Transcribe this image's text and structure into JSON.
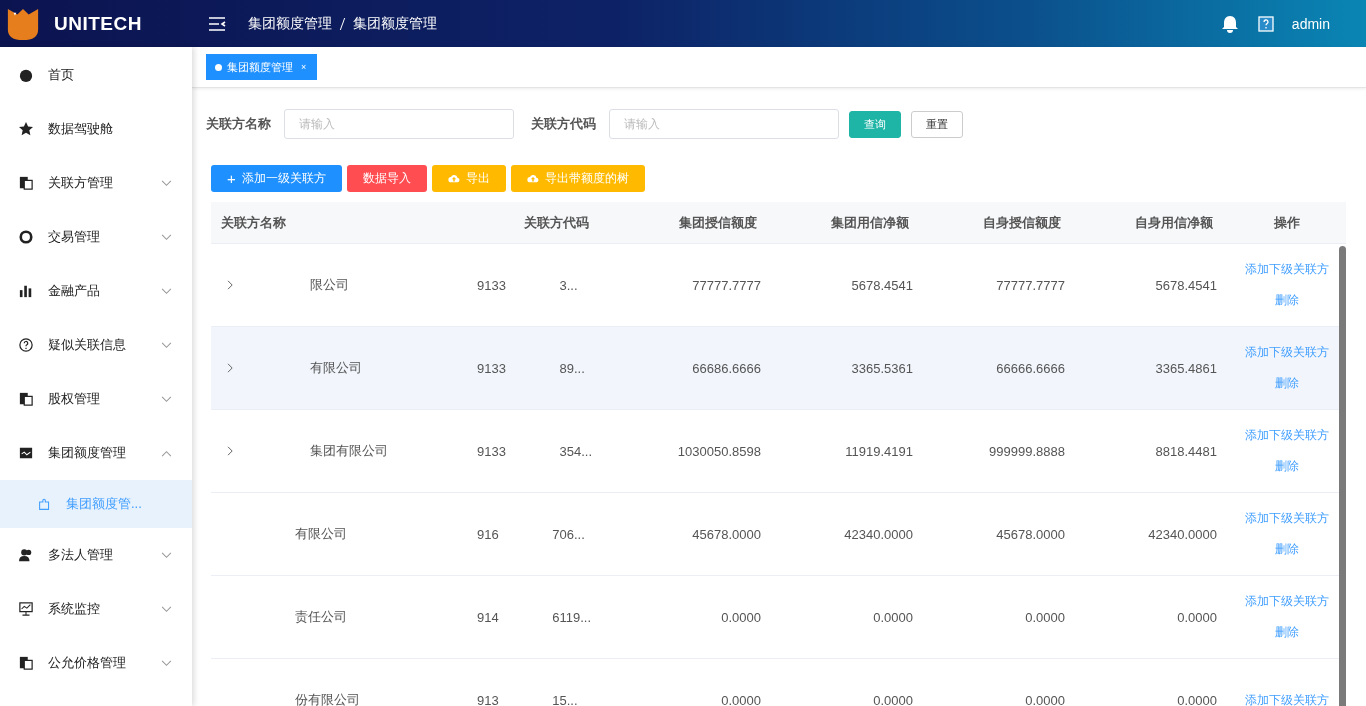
{
  "header": {
    "logo": "UNITECH",
    "breadcrumb": [
      "集团额度管理",
      "集团额度管理"
    ],
    "user": "admin"
  },
  "sidebar": {
    "items": [
      {
        "label": "首页",
        "kind": "link"
      },
      {
        "label": "数据驾驶舱",
        "kind": "link"
      },
      {
        "label": "关联方管理",
        "kind": "submenu",
        "expanded": false
      },
      {
        "label": "交易管理",
        "kind": "submenu",
        "expanded": false
      },
      {
        "label": "金融产品",
        "kind": "submenu",
        "expanded": false
      },
      {
        "label": "疑似关联信息",
        "kind": "submenu",
        "expanded": false
      },
      {
        "label": "股权管理",
        "kind": "submenu",
        "expanded": false
      },
      {
        "label": "集团额度管理",
        "kind": "submenu",
        "expanded": true,
        "children": [
          {
            "label": "集团额度管...",
            "selected": true
          }
        ]
      },
      {
        "label": "多法人管理",
        "kind": "submenu",
        "expanded": false
      },
      {
        "label": "系统监控",
        "kind": "submenu",
        "expanded": false
      },
      {
        "label": "公允价格管理",
        "kind": "submenu",
        "expanded": false
      }
    ]
  },
  "tabs": [
    {
      "label": "集团额度管理",
      "selected": true,
      "close": "×"
    }
  ],
  "filters": [
    {
      "label": "关联方名称",
      "placeholder": "请输入"
    },
    {
      "label": "关联方代码",
      "placeholder": "请输入"
    }
  ],
  "filter_buttons": [
    {
      "label": "查询",
      "kind": "primary"
    },
    {
      "label": "重置",
      "kind": "plain"
    }
  ],
  "toolbar": [
    {
      "label": "添加一级关联方",
      "kind": "add",
      "icon": "+"
    },
    {
      "label": "数据导入",
      "kind": "danger"
    },
    {
      "label": "导出",
      "kind": "export"
    },
    {
      "label": "导出带额度的树",
      "kind": "export"
    }
  ],
  "table": {
    "columns": [
      "关联方名称",
      "关联方代码",
      "集团授信额度",
      "集团用信净额",
      "自身授信额度",
      "自身用信净额",
      "操作"
    ],
    "rows": [
      {
        "expandable": true,
        "highlighted": false,
        "cells": [
          "限公司",
          "9133 3...",
          "77777.7777",
          "5678.4541",
          "77777.7777",
          "5678.4541"
        ],
        "actions": [
          "添加下级关联方",
          "删除"
        ]
      },
      {
        "expandable": true,
        "highlighted": true,
        "cells": [
          "有限公司",
          "9133 89...",
          "66686.6666",
          "3365.5361",
          "66666.6666",
          "3365.4861"
        ],
        "actions": [
          "添加下级关联方",
          "删除"
        ]
      },
      {
        "expandable": true,
        "highlighted": false,
        "cells": [
          "集团有限公司",
          "9133 354...",
          "1030050.8598",
          "11919.4191",
          "999999.8888",
          "8818.4481"
        ],
        "actions": [
          "添加下级关联方",
          "删除"
        ]
      },
      {
        "expandable": false,
        "highlighted": false,
        "cells": [
          "有限公司",
          "916 706...",
          "45678.0000",
          "42340.0000",
          "45678.0000",
          "42340.0000"
        ],
        "actions": [
          "添加下级关联方",
          "删除"
        ]
      },
      {
        "expandable": false,
        "highlighted": false,
        "cells": [
          "责任公司",
          "914 6119...",
          "0.0000",
          "0.0000",
          "0.0000",
          "0.0000"
        ],
        "actions": [
          "添加下级关联方",
          "删除"
        ]
      },
      {
        "expandable": false,
        "highlighted": false,
        "cells": [
          "份有限公司",
          "913 15...",
          "0.0000",
          "0.0000",
          "0.0000",
          "0.0000"
        ],
        "actions": [
          "添加下级关联方"
        ]
      }
    ]
  }
}
